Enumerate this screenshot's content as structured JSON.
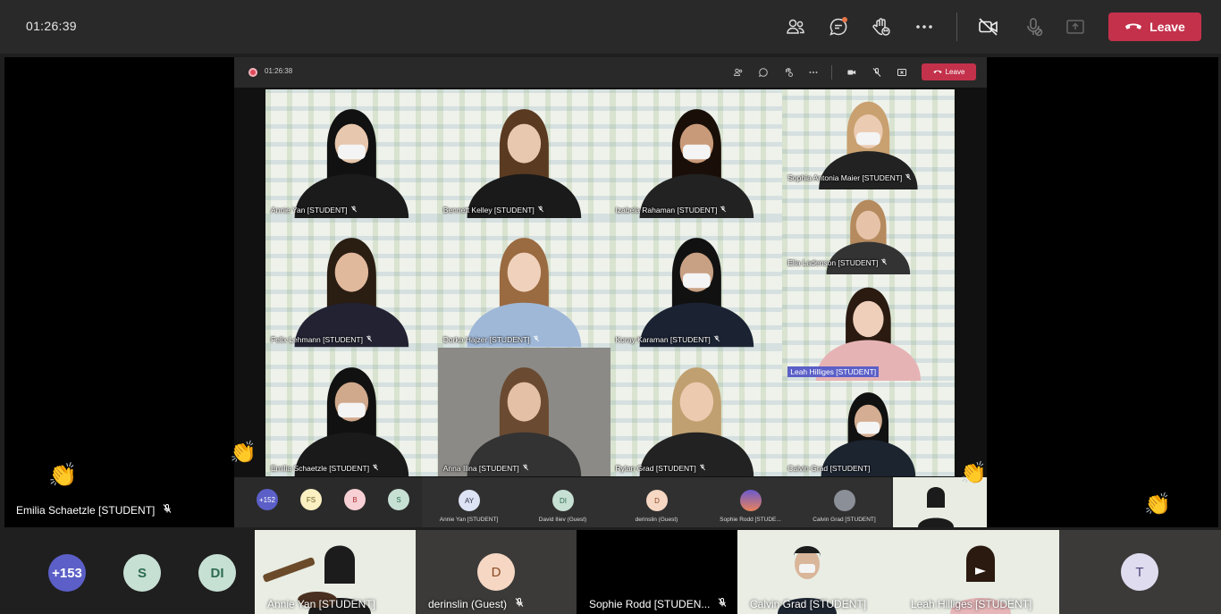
{
  "topbar": {
    "timer": "01:26:39",
    "leave_label": "Leave"
  },
  "shared_screen": {
    "timer": "01:26:38",
    "leave_label": "Leave",
    "tiles": [
      {
        "name": "Annie Yan [STUDENT]"
      },
      {
        "name": "Bennett Kelley [STUDENT]"
      },
      {
        "name": "Izabela Rahaman [STUDENT]"
      },
      {
        "name": "Sophia Antonia Maier [STUDENT]"
      },
      {
        "name": "Elia Ladenson [STUDENT]"
      },
      {
        "name": "Felix Lehmann [STUDENT]"
      },
      {
        "name": "Dorka Hajzer [STUDENT]"
      },
      {
        "name": "Koray Karaman [STUDENT]"
      },
      {
        "name": "Leah Hilliges [STUDENT]"
      },
      {
        "name": "Emilia Schaetzle [STUDENT]"
      },
      {
        "name": "Anna Ilina [STUDENT]"
      },
      {
        "name": "Rylan Grad [STUDENT]"
      },
      {
        "name": "Calvin Grad [STUDENT]"
      }
    ],
    "strip_chips": [
      "+152",
      "FS",
      "B",
      "S"
    ],
    "strip_tiles": [
      {
        "initials": "AY",
        "name": "Annie Yan [STUDENT]"
      },
      {
        "initials": "DI",
        "name": "David Iliev (Guest)"
      },
      {
        "initials": "D",
        "name": "derinslin (Guest)"
      },
      {
        "initials": "",
        "name": "Sophie Rodd [STUDE..."
      },
      {
        "initials": "",
        "name": "Calvin Grad [STUDENT]"
      }
    ]
  },
  "stage": {
    "presenter_label": "Emilia Schaetzle [STUDENT]"
  },
  "participants": {
    "overflow": "+153",
    "chips": [
      "S",
      "DI"
    ],
    "tiles": [
      {
        "name": "Annie Yan [STUDENT]"
      },
      {
        "initials": "D",
        "name": "derinslin (Guest)"
      },
      {
        "name": "Sophie Rodd [STUDEN..."
      },
      {
        "name": "Calvin Grad [STUDENT]"
      },
      {
        "name": "Leah Hilliges [STUDENT]"
      },
      {
        "initials": "T"
      }
    ]
  },
  "icons": {
    "people": "people-icon",
    "chat": "chat-icon",
    "react": "raise-hand-icon",
    "more": "more-icon",
    "camera": "camera-off-icon",
    "mic": "mic-off-icon",
    "share": "share-tray-icon",
    "hangup": "phone-hangup-icon",
    "reaction": "clap-reaction-icon"
  },
  "colors": {
    "leave": "#c4314b",
    "overflow_chip": "#5b5fc7",
    "avatar_green": "#c7e0d4",
    "avatar_peach": "#f6d7c3",
    "avatar_lavender": "#e0dcf0"
  }
}
